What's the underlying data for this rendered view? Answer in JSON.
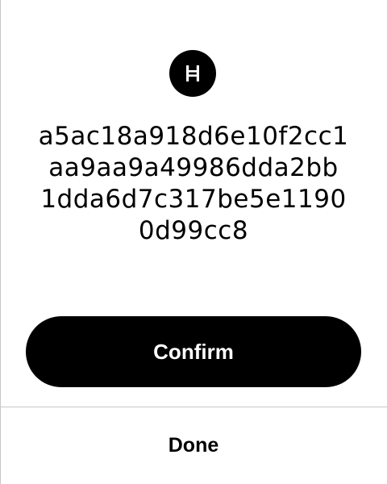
{
  "logo": {
    "icon": "hbar-icon",
    "background": "#000000"
  },
  "transaction": {
    "hash_lines": [
      "a5ac18a918d6e10f2cc1",
      "aa9aa9a49986dda2bb",
      "1dda6d7c317be5e1190",
      "0d99cc8"
    ]
  },
  "actions": {
    "confirm_label": "Confirm",
    "done_label": "Done"
  },
  "colors": {
    "primary": "#000000",
    "on_primary": "#ffffff",
    "divider": "#c8c8c8"
  }
}
